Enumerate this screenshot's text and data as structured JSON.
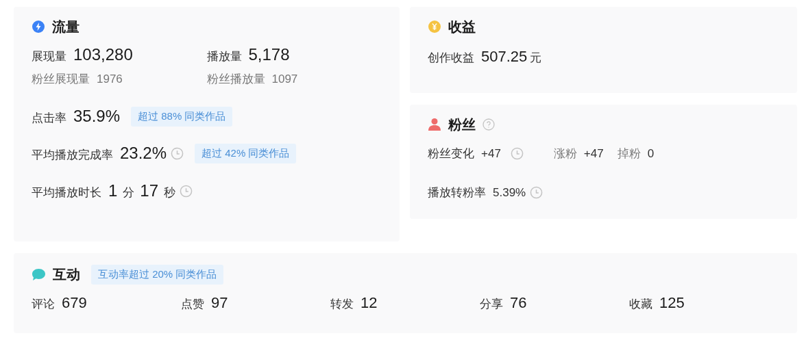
{
  "traffic": {
    "title": "流量",
    "primary": [
      {
        "label": "展现量",
        "value": "103,280"
      },
      {
        "label": "播放量",
        "value": "5,178"
      }
    ],
    "secondary": [
      {
        "label": "粉丝展现量",
        "value": "1976"
      },
      {
        "label": "粉丝播放量",
        "value": "1097"
      }
    ],
    "rates": [
      {
        "label": "点击率",
        "value": "35.9%",
        "history": false,
        "badge": "超过 88% 同类作品"
      },
      {
        "label": "平均播放完成率",
        "value": "23.2%",
        "history": true,
        "badge": "超过 42% 同类作品"
      }
    ],
    "duration": {
      "label": "平均播放时长",
      "minutes": "1",
      "minute_unit": "分",
      "seconds": "17",
      "second_unit": "秒",
      "history": true
    }
  },
  "revenue": {
    "title": "收益",
    "label": "创作收益",
    "value": "507.25",
    "unit": "元"
  },
  "fans": {
    "title": "粉丝",
    "changes": [
      {
        "label": "粉丝变化",
        "value": "+47",
        "history": true
      },
      {
        "label": "涨粉",
        "value": "+47",
        "history": false
      },
      {
        "label": "掉粉",
        "value": "0",
        "history": false
      }
    ],
    "conversion": {
      "label": "播放转粉率",
      "value": "5.39%",
      "history": true
    }
  },
  "interaction": {
    "title": "互动",
    "badge": "互动率超过 20% 同类作品",
    "items": [
      {
        "label": "评论",
        "value": "679"
      },
      {
        "label": "点赞",
        "value": "97"
      },
      {
        "label": "转发",
        "value": "12"
      },
      {
        "label": "分享",
        "value": "76"
      },
      {
        "label": "收藏",
        "value": "125"
      }
    ]
  }
}
